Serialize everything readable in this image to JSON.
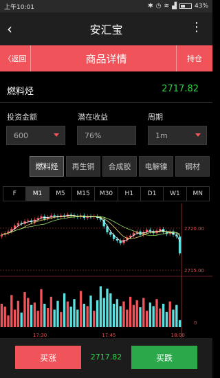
{
  "status": {
    "time": "上午10:01",
    "battery": "43%"
  },
  "appbar": {
    "title": "安汇宝"
  },
  "subbar": {
    "back_label": "〈返回",
    "title": "商品详情",
    "hold_label": "持仓"
  },
  "product": {
    "name": "燃料烃",
    "price": "2717.82"
  },
  "form": {
    "amount_label": "投资金额",
    "amount_value": "600",
    "profit_label": "潜在收益",
    "profit_value": "76%",
    "period_label": "周期",
    "period_value": "1m"
  },
  "product_tabs": [
    "燃料烃",
    "再生铜",
    "合成胶",
    "电解镍",
    "钢材"
  ],
  "time_tabs": [
    "F",
    "M1",
    "M5",
    "M15",
    "M30",
    "H1",
    "D1",
    "W1",
    "MN"
  ],
  "chart_data": {
    "type": "candlestick",
    "price_labels": [
      "2720.00",
      "2715.00"
    ],
    "volume_label": "0",
    "time_labels": [
      "17:30",
      "17:45",
      "18:00"
    ],
    "closes": [
      2719.2,
      2719.4,
      2719.6,
      2719.9,
      2720.3,
      2720.6,
      2720.5,
      2720.8,
      2720.9,
      2720.7,
      2721.0,
      2721.2,
      2721.4,
      2721.1,
      2721.3,
      2721.5,
      2721.4,
      2721.3,
      2721.5,
      2721.4,
      2721.6,
      2721.5,
      2721.4,
      2721.3,
      2721.5,
      2721.2,
      2721.4,
      2721.3,
      2721.4,
      2721.2,
      2721.0,
      2720.2,
      2719.5,
      2719.2,
      2718.7,
      2718.5,
      2718.2,
      2718.6,
      2718.9,
      2719.1,
      2719.4,
      2719.6,
      2719.2,
      2719.5,
      2719.8,
      2719.6,
      2719.4,
      2719.7,
      2719.9,
      2719.5,
      2719.3,
      2719.6,
      2719.2,
      2719.0,
      2717.0
    ],
    "volumes": [
      40,
      35,
      20,
      55,
      30,
      45,
      25,
      60,
      50,
      38,
      42,
      28,
      65,
      40,
      33,
      52,
      30,
      45,
      26,
      58,
      44,
      35,
      48,
      30,
      62,
      40,
      36,
      54,
      28,
      46,
      70,
      50,
      66,
      58,
      40,
      48,
      36,
      44,
      30,
      52,
      38,
      46,
      34,
      50,
      28,
      42,
      36,
      48,
      32,
      40,
      26,
      44,
      30,
      38,
      12
    ],
    "colors": {
      "up": "#f0545a",
      "down": "#5ce0e0",
      "ma1": "#ffffff",
      "ma2": "#f0e06a",
      "ma3": "#9be36c"
    }
  },
  "bottom": {
    "buy_up": "买涨",
    "price": "2717.82",
    "buy_down": "买跌"
  }
}
